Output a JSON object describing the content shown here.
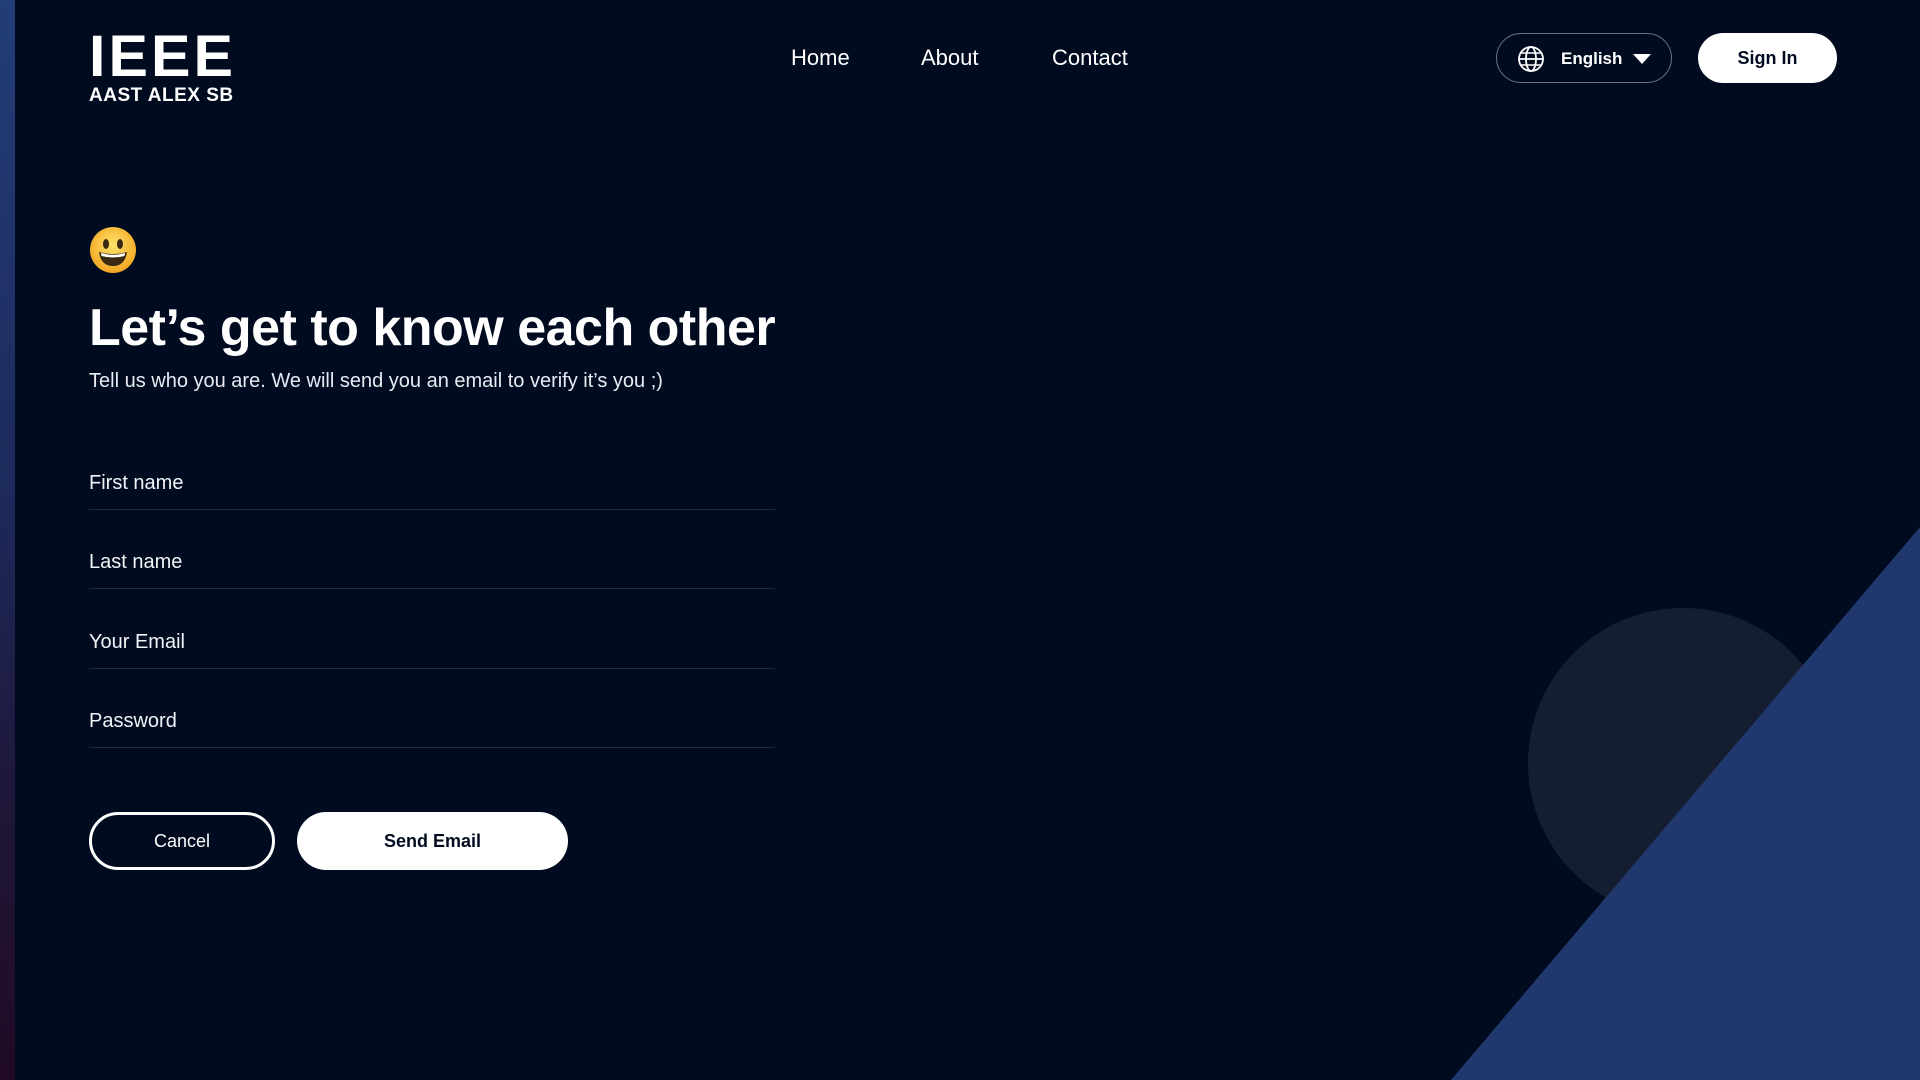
{
  "header": {
    "logo_main": "IEEE",
    "logo_sub": "AAST ALEX SB",
    "nav": [
      {
        "label": "Home"
      },
      {
        "label": "About"
      },
      {
        "label": "Contact"
      }
    ],
    "language": {
      "selected": "English",
      "icon": "globe-icon",
      "chevron": "chevron-down-icon"
    },
    "sign_in_label": "Sign In"
  },
  "main": {
    "emoji": "grinning-face-emoji",
    "title": "Let’s get to know each other",
    "subtitle": "Tell us who you are. We will send you an email to verify it’s you ;)",
    "fields": {
      "first_name": {
        "placeholder": "First name",
        "value": ""
      },
      "last_name": {
        "placeholder": "Last name",
        "value": ""
      },
      "email": {
        "placeholder": "Your Email",
        "value": ""
      },
      "password": {
        "placeholder": "Password",
        "value": ""
      }
    },
    "cancel_label": "Cancel",
    "send_label": "Send Email"
  },
  "colors": {
    "background": "#000b20",
    "accent_triangle": "#21386e",
    "deco_circle": "#141e30",
    "button_fill": "#ffffff"
  }
}
